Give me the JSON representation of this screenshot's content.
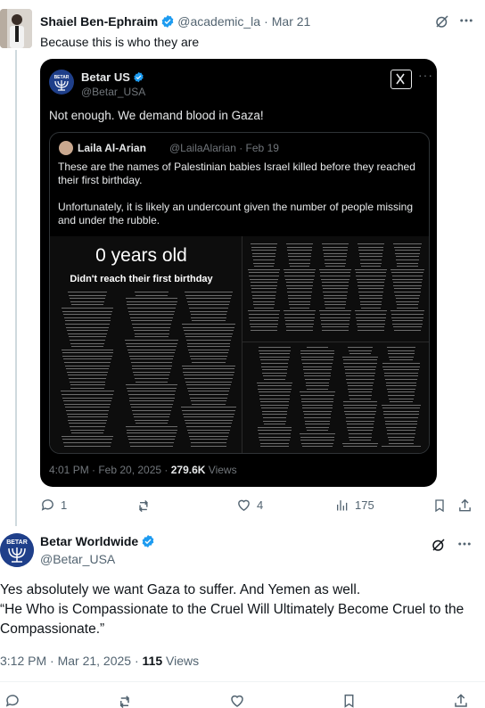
{
  "tweet1": {
    "author_name": "Shaiel Ben-Ephraim",
    "handle": "@academic_la",
    "separator": "·",
    "date": "Mar 21",
    "text": "Because this is who they are",
    "actions": {
      "replies": "1",
      "reposts": "",
      "likes": "4",
      "views": "175"
    }
  },
  "embedded_post": {
    "author_name": "Betar US",
    "handle": "@Betar_USA",
    "text": "Not enough. We demand blood in Gaza!",
    "timestamp": "4:01 PM · Feb 20, 2025 · ",
    "views_count": "279.6K",
    "views_label": " Views",
    "quoted": {
      "author_name": "Laila Al-Arian",
      "handle_date": "@LailaAlarian · Feb 19",
      "paragraph1": "These are the names of Palestinian babies Israel killed before they reached their first birthday.",
      "paragraph2": "Unfortunately, it is likely an undercount given the number of people missing and under the rubble.",
      "image_title": "0 years old",
      "image_subtitle": "Didn't reach their first birthday"
    }
  },
  "tweet2": {
    "author_name": "Betar Worldwide",
    "handle": "@Betar_USA",
    "logo_text": "BETAR",
    "text_line1": "Yes absolutely we want Gaza to suffer. And Yemen as well.",
    "text_line2": "“He Who is Compassionate to the Cruel Will Ultimately Become Cruel to the Compassionate.”",
    "timestamp": "3:12 PM · Mar 21, 2025 · ",
    "views_count": "115",
    "views_label": " Views"
  },
  "colors": {
    "verified_blue": "#1d9bf0",
    "text_primary": "#0f1419",
    "text_secondary": "#536471",
    "card_bg": "#000000"
  },
  "icons": [
    "verified-badge-icon",
    "grok-icon",
    "more-icon",
    "reply-icon",
    "repost-icon",
    "like-icon",
    "views-icon",
    "bookmark-icon",
    "share-icon",
    "x-logo-icon"
  ]
}
